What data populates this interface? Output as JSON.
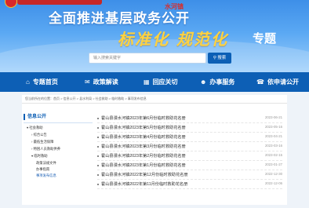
{
  "header": {
    "title": "全面推进基层政务公开",
    "slogan": "标准化 规范化",
    "slogan_suffix": "专题",
    "seal_text": "水河镇"
  },
  "search": {
    "placeholder": "输入搜索关键字",
    "button_label": "搜索"
  },
  "nav": [
    {
      "label": "专题首页",
      "icon": "home-icon"
    },
    {
      "label": "政策解读",
      "icon": "chat-icon"
    },
    {
      "label": "回应关切",
      "icon": "grid-icon"
    },
    {
      "label": "办事服务",
      "icon": "person-icon"
    },
    {
      "label": "依申请公开",
      "icon": "phone-icon"
    }
  ],
  "breadcrumb": "您当前所在的位置：首页 > 信息公开 > 县水利局 > 社会救助 > 临时救助 > 事项发布信息",
  "sidebar": {
    "title": "信息公开",
    "items": [
      "社会救助",
      "综合公告",
      "最低生活保障",
      "特困人员救助供养",
      "临时救助",
      "政策法规文件",
      "办事指南",
      "事项发布信息"
    ]
  },
  "articles": [
    {
      "title": "霍山县漫水河镇2023年第6月份临时救助花名册",
      "date": "2023-06-21"
    },
    {
      "title": "霍山县漫水河镇2023年第5月份临时救助花名册",
      "date": "2023-05-16"
    },
    {
      "title": "霍山县漫水河镇2023年第4月份临时救助花名册",
      "date": "2023-04-21"
    },
    {
      "title": "霍山县漫水河镇2023年第3月份临时救助花名册",
      "date": "2023-03-16"
    },
    {
      "title": "霍山县漫水河镇2023年第2月份临时救助花名册",
      "date": "2023-02-15"
    },
    {
      "title": "霍山县漫水河镇2023年第1月份临时救助花名册",
      "date": "2023-01-27"
    },
    {
      "title": "霍山县漫水河镇2022年第12月份临时救助花名册",
      "date": "2022-12-30"
    },
    {
      "title": "霍山县漫水河镇2022年第11月份临时救助花名册",
      "date": "2022-12-06"
    }
  ],
  "colors": {
    "nav_bg": "#0d5fb5",
    "slogan": "#ffd23f",
    "banner": "#4a9cee"
  }
}
